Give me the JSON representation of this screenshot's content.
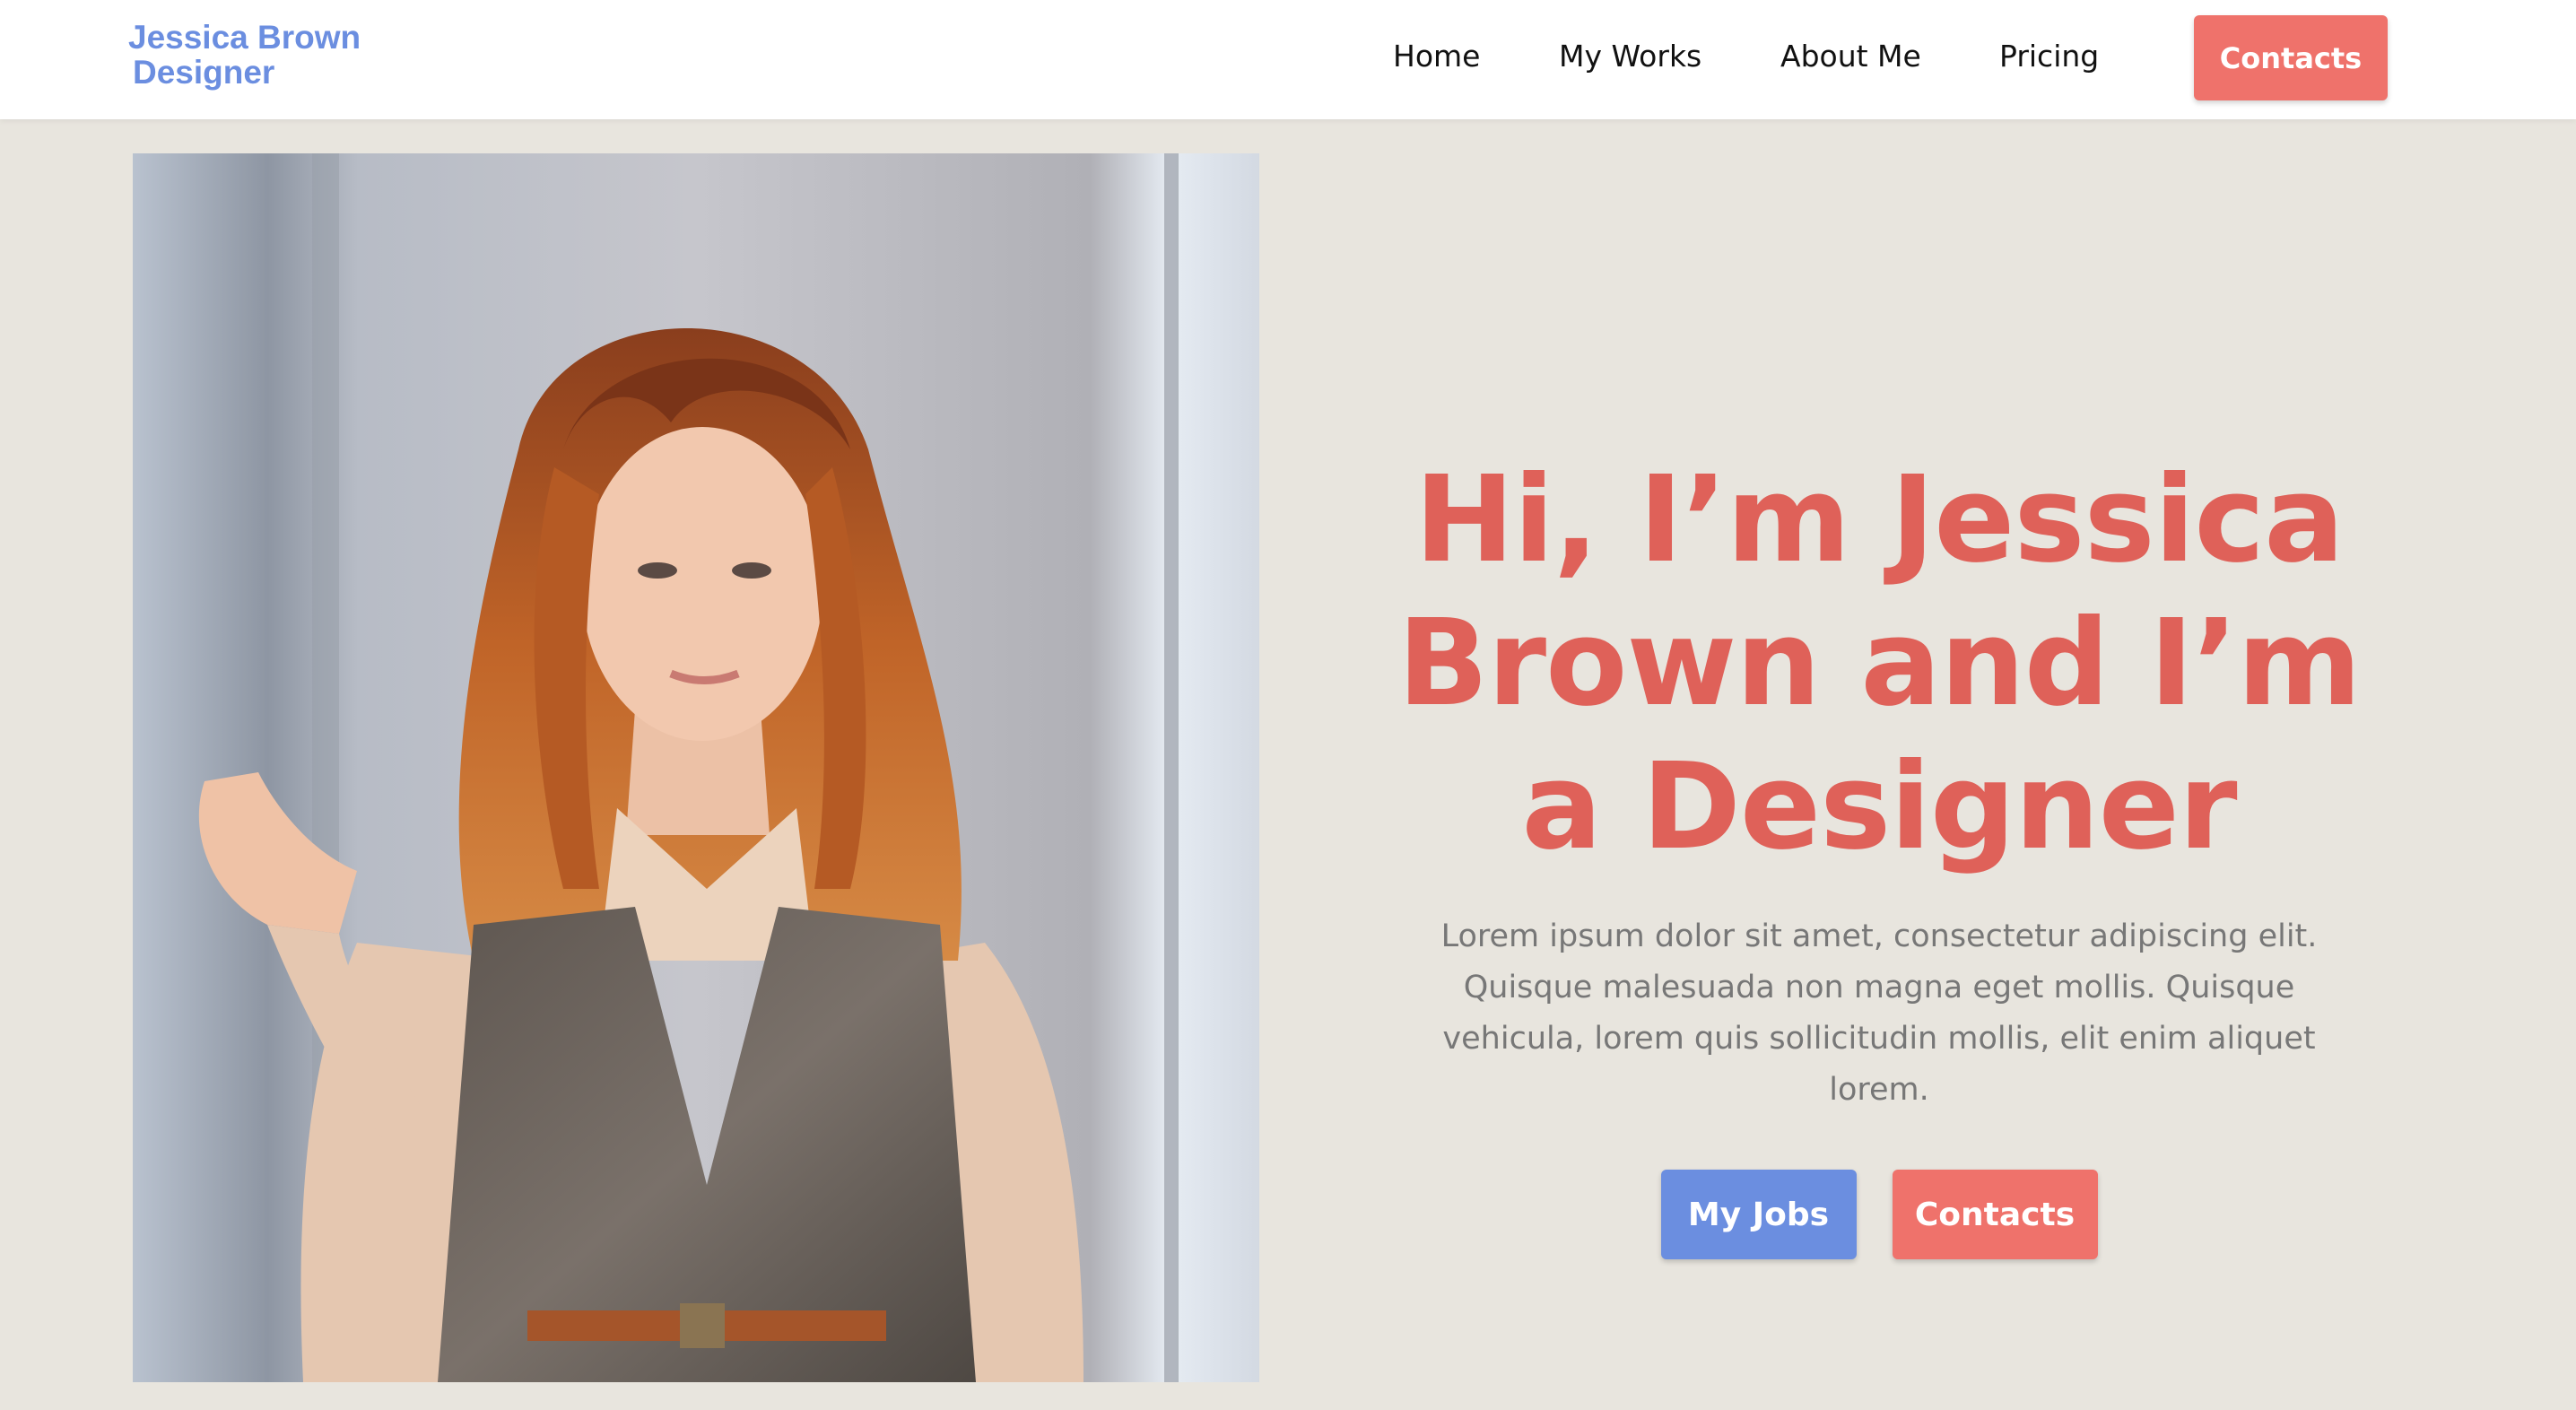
{
  "header": {
    "logo_line1": "Jessica Brown",
    "logo_line2": "Designer",
    "nav": {
      "home": "Home",
      "my_works": "My Works",
      "about_me": "About Me",
      "pricing": "Pricing",
      "contacts": "Contacts"
    }
  },
  "hero": {
    "photo_icon": "portrait-photo",
    "title": "Hi, I’m Jessica Brown and I’m a Designer",
    "description": "Lorem ipsum dolor sit amet, consectetur adipiscing elit. Quisque malesuada non magna eget mollis. Quisque vehicula, lorem quis sollicitudin mollis, elit enim aliquet lorem.",
    "buttons": {
      "my_jobs": "My Jobs",
      "contacts": "Contacts"
    }
  },
  "colors": {
    "accent_blue": "#6b8ee0",
    "accent_red": "#ef726b",
    "title_red": "#df6159",
    "background": "#e8e5de"
  }
}
